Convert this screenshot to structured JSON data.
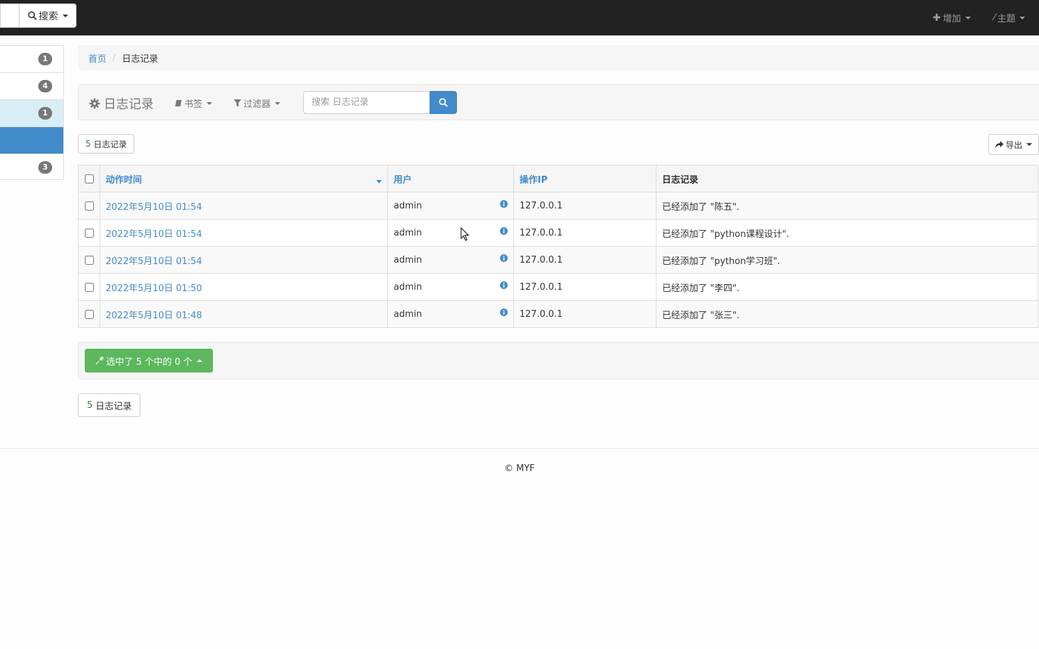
{
  "navbar": {
    "search_label": "搜索",
    "add_label": "增加",
    "theme_label": "主题"
  },
  "sidebar": {
    "badges": [
      "1",
      "4",
      "1",
      "",
      "3"
    ]
  },
  "breadcrumb": {
    "home": "首页",
    "current": "日志记录"
  },
  "toolbar": {
    "title": "日志记录",
    "bookmarks": "书签",
    "filters": "过滤器",
    "search_placeholder": "搜索 日志记录"
  },
  "result_count": {
    "number": "5",
    "label": "日志记录"
  },
  "export_label": "导出",
  "table": {
    "headers": {
      "time": "动作时间",
      "user": "用户",
      "ip": "操作IP",
      "log": "日志记录"
    },
    "rows": [
      {
        "time": "2022年5月10日 01:54",
        "user": "admin",
        "ip": "127.0.0.1",
        "log": "已经添加了 \"陈五\"."
      },
      {
        "time": "2022年5月10日 01:54",
        "user": "admin",
        "ip": "127.0.0.1",
        "log": "已经添加了 \"python课程设计\"."
      },
      {
        "time": "2022年5月10日 01:54",
        "user": "admin",
        "ip": "127.0.0.1",
        "log": "已经添加了 \"python学习班\"."
      },
      {
        "time": "2022年5月10日 01:50",
        "user": "admin",
        "ip": "127.0.0.1",
        "log": "已经添加了 \"李四\"."
      },
      {
        "time": "2022年5月10日 01:48",
        "user": "admin",
        "ip": "127.0.0.1",
        "log": "已经添加了 \"张三\"."
      }
    ]
  },
  "action_bar": {
    "selected_label": "选中了 5 个中的 0 个"
  },
  "footer": {
    "copyright": "© MYF"
  }
}
